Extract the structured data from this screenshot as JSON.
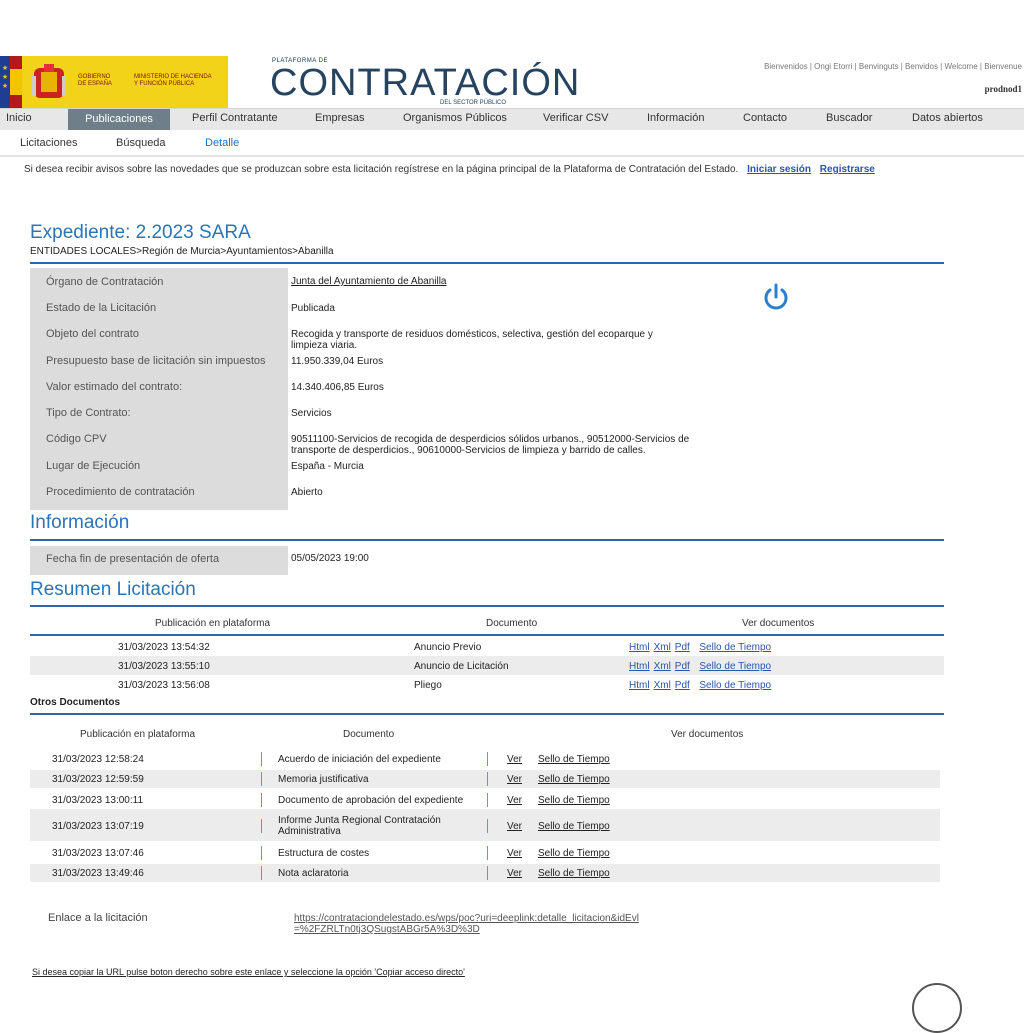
{
  "header": {
    "gobierno": "GOBIERNO DE ESPAÑA",
    "ministerio": "MINISTERIO DE HACIENDA Y FUNCIÓN PÚBLICA",
    "plataforma_de": "PLATAFORMA DE",
    "contratacion": "CONTRATACIÓN",
    "sector_publico": "DEL SECTOR PÚBLICO",
    "welcome": "Bienvenidos | Ongi Etorri | Benvinguts | Benvidos | Welcome | Bienvenue",
    "server": "prodnod1"
  },
  "nav": [
    "Inicio",
    "Publicaciones",
    "Perfil Contratante",
    "Empresas",
    "Organismos Públicos",
    "Verificar CSV",
    "Información",
    "Contacto",
    "Buscador",
    "Datos abiertos"
  ],
  "subnav": [
    "Licitaciones",
    "Búsqueda",
    "Detalle"
  ],
  "notice": {
    "text": "Si desea recibir avisos sobre las novedades que se produzcan sobre esta licitación regístrese en la página principal de la Plataforma de Contratación del Estado.",
    "login": "Iniciar sesión",
    "register": "Registrarse"
  },
  "expediente": {
    "title": "Expediente:  2.2023 SARA",
    "breadcrumb": "ENTIDADES LOCALES>Región de Murcia>Ayuntamientos>Abanilla"
  },
  "details": {
    "organo_label": "Órgano de Contratación",
    "organo_value": "Junta del Ayuntamiento de Abanilla",
    "estado_label": "Estado de la Licitación",
    "estado_value": "Publicada",
    "objeto_label": "Objeto del contrato",
    "objeto_value": "Recogida y transporte de residuos domésticos, selectiva, gestión del ecoparque y limpieza viaria.",
    "presupuesto_label": "Presupuesto base de licitación sin impuestos",
    "presupuesto_value": "11.950.339,04  Euros",
    "valor_label": "Valor estimado del contrato:",
    "valor_value": "14.340.406,85  Euros",
    "tipo_label": "Tipo de Contrato:",
    "tipo_value": "Servicios",
    "cpv_label": "Código CPV",
    "cpv_value": "90511100-Servicios de recogida de desperdicios sólidos urbanos., 90512000-Servicios de transporte de desperdicios., 90610000-Servicios de limpieza y barrido de calles.",
    "lugar_label": "Lugar de Ejecución",
    "lugar_value": "España - Murcia",
    "proc_label": "Procedimiento de contratación",
    "proc_value": "Abierto"
  },
  "informacion": {
    "title": "Información",
    "fecha_label": "Fecha fin de presentación de oferta",
    "fecha_value": "05/05/2023 19:00"
  },
  "resumen": {
    "title": "Resumen Licitación",
    "headers": [
      "Publicación en plataforma",
      "Documento",
      "Ver documentos"
    ],
    "rows": [
      {
        "date": "31/03/2023 13:54:32",
        "doc": "Anuncio Previo"
      },
      {
        "date": "31/03/2023 13:55:10",
        "doc": "Anuncio de Licitación"
      },
      {
        "date": "31/03/2023 13:56:08",
        "doc": "Pliego"
      }
    ],
    "link_html": "Html",
    "link_xml": "Xml",
    "link_pdf": "Pdf",
    "link_sello": "Sello de Tiempo"
  },
  "otros": {
    "title": "Otros Documentos",
    "headers": [
      "Publicación en plataforma",
      "Documento",
      "Ver documentos"
    ],
    "rows": [
      {
        "date": "31/03/2023 12:58:24",
        "doc": "Acuerdo de iniciación del expediente"
      },
      {
        "date": "31/03/2023 12:59:59",
        "doc": "Memoria justificativa"
      },
      {
        "date": "31/03/2023 13:00:11",
        "doc": "Documento de aprobación del expediente"
      },
      {
        "date": "31/03/2023 13:07:19",
        "doc": "Informe Junta Regional Contratación Administrativa"
      },
      {
        "date": "31/03/2023 13:07:46",
        "doc": "Estructura de costes"
      },
      {
        "date": "31/03/2023 13:49:46",
        "doc": "Nota aclaratoria"
      }
    ],
    "link_ver": "Ver",
    "link_sello": "Sello de Tiempo"
  },
  "enlace": {
    "label": "Enlace a la licitación",
    "url": "https://contrataciondelestado.es/wps/poc?uri=deeplink:detalle_licitacion&idEvl=%2FZRLTn0tj3QSugstABGr5A%3D%3D",
    "copy_hint": "Si desea copiar la URL pulse boton derecho sobre este enlace y seleccione la opción 'Copiar acceso directo'"
  }
}
